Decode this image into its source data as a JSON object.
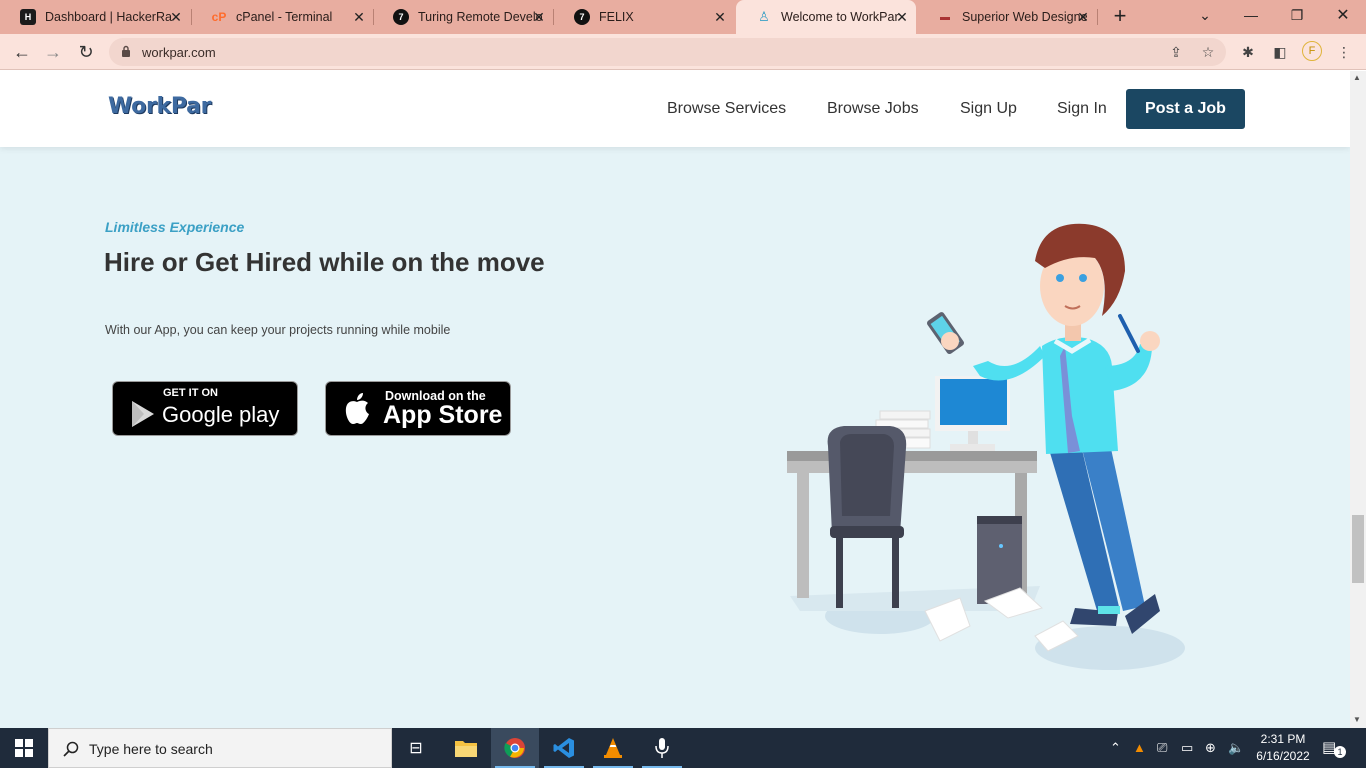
{
  "browser": {
    "tabs": [
      {
        "title": "Dashboard | HackerRa",
        "icon": "hackerrank-icon"
      },
      {
        "title": "cPanel - Terminal",
        "icon": "cpanel-icon"
      },
      {
        "title": "Turing Remote Develo",
        "icon": "turing-icon"
      },
      {
        "title": "FELIX",
        "icon": "turing-icon"
      },
      {
        "title": "Welcome to WorkPar",
        "icon": "workpar-icon",
        "active": true
      },
      {
        "title": "Superior Web Designe",
        "icon": "web-designer-icon"
      }
    ],
    "url": "workpar.com",
    "profile_initial": "F"
  },
  "site": {
    "logo": "WorkPar",
    "nav": [
      "Browse Services",
      "Browse Jobs",
      "Sign Up",
      "Sign In"
    ],
    "cta": "Post a Job"
  },
  "hero": {
    "eyebrow": "Limitless Experience",
    "headline": "Hire or Get Hired while on the move",
    "subtext": "With our App, you can keep your projects running while mobile",
    "google_play": {
      "small": "GET IT ON",
      "big": "Google play"
    },
    "app_store": {
      "small": "Download on the",
      "big": "App Store"
    }
  },
  "taskbar": {
    "search_placeholder": "Type here to search",
    "time": "2:31 PM",
    "date": "6/16/2022",
    "notification_count": "1"
  },
  "colors": {
    "tab_strip": "#e8ada0",
    "toolbar": "#fbe3dc",
    "page_bg": "#e5f3f7",
    "cta_bg": "#1b4762",
    "eyebrow": "#3ba0c5"
  }
}
